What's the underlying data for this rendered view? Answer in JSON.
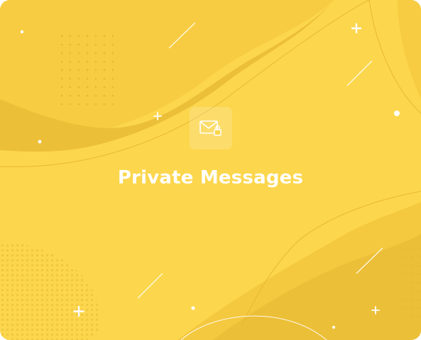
{
  "card": {
    "title": "Private Messages",
    "icon": "envelope-lock-icon"
  },
  "colors": {
    "background": "#fcd64c",
    "wave_dark": "#f0c33c",
    "wave_light": "#f7cc42",
    "decoration": "#ffffff",
    "text": "#ffffff"
  }
}
